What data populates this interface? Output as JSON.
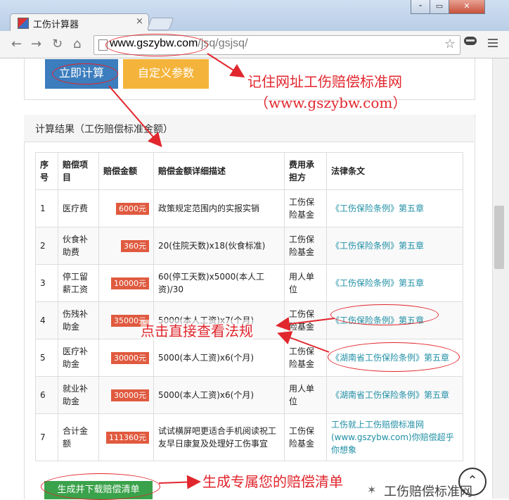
{
  "browser": {
    "tab_title": "工伤计算器",
    "tab_close": "×",
    "url_domain": "www.gszybw.com",
    "url_path": "/jsq/gsjsq/",
    "window_buttons": [
      "⁃",
      "▭",
      "✕"
    ]
  },
  "actions": {
    "calc_button": "立即计算",
    "custom_button": "自定义参数",
    "generate_button": "生成并下载赔偿清单"
  },
  "results": {
    "title": "计算结果（工伤赔偿标准金额）",
    "headers": [
      "序号",
      "赔偿项目",
      "赔偿金额",
      "赔偿金额详细描述",
      "费用承担方",
      "法律条文"
    ],
    "rows": [
      {
        "no": "1",
        "item": "医疗费",
        "amount": "6000元",
        "desc": "政策规定范围内的实报实销",
        "payer": "工伤保险基金",
        "law": "《工伤保险条例》第五章"
      },
      {
        "no": "2",
        "item": "伙食补助费",
        "amount": "360元",
        "desc": "20(住院天数)x18(伙食标准)",
        "payer": "工伤保险基金",
        "law": "《工伤保险条例》第五章"
      },
      {
        "no": "3",
        "item": "停工留薪工资",
        "amount": "10000元",
        "desc": "60(停工天数)x5000(本人工资)/30",
        "payer": "用人单位",
        "law": "《工伤保险条例》第五章"
      },
      {
        "no": "4",
        "item": "伤残补助金",
        "amount": "35000元",
        "desc": "5000(本人工资)x7(个月)",
        "payer": "工伤保险基金",
        "law": "《工伤保险条例》第五章"
      },
      {
        "no": "5",
        "item": "医疗补助金",
        "amount": "30000元",
        "desc": "5000(本人工资)x6(个月)",
        "payer": "工伤保险基金",
        "law": "《湖南省工伤保险条例》第五章"
      },
      {
        "no": "6",
        "item": "就业补助金",
        "amount": "30000元",
        "desc": "5000(本人工资)x6(个月)",
        "payer": "用人单位",
        "law": "《湖南省工伤保险条例》第五章"
      },
      {
        "no": "7",
        "item": "合计金额",
        "amount": "111360元",
        "desc": "试试横屏吧更适合手机阅读祝工友早日康复及处理好工伤事宜",
        "payer": "工伤保险基金",
        "law": "工伤就上工伤赔偿标准网(www.gszybw.com)你赔偿超乎你想象"
      }
    ]
  },
  "annotations": {
    "remember_url": "记住网址工伤赔偿标准网",
    "remember_url_sub": "（www.gszybw.com）",
    "click_law": "点击直接查看法规",
    "generate_list": "生成专属您的赔偿清单"
  },
  "watermark": "工伤赔偿标准网",
  "icons": {
    "back": "back-arrow-icon",
    "forward": "forward-arrow-icon",
    "reload": "reload-icon",
    "home": "home-icon",
    "star": "bookmark-star-icon",
    "menu": "hamburger-menu-icon",
    "scroll_top": "scroll-to-top-icon"
  },
  "colors": {
    "calc_button": "#3b7dbd",
    "custom_button": "#f4b43b",
    "amount_badge": "#e05a3f",
    "law_link": "#1f8fa5",
    "generate_button": "#3aa24a",
    "annotation": "#e1262d"
  }
}
